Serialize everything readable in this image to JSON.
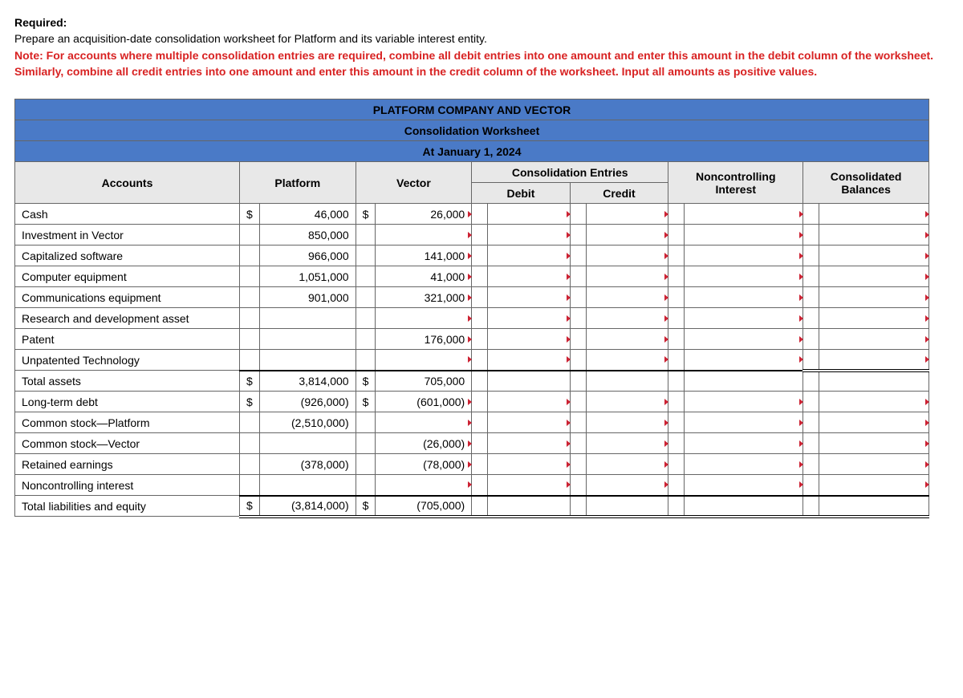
{
  "instructions": {
    "required_label": "Required:",
    "line1": "Prepare an acquisition-date consolidation worksheet for Platform and its variable interest entity.",
    "note": "Note: For accounts where multiple consolidation entries are required, combine all debit entries into one amount and enter this amount in the debit column of the worksheet. Similarly, combine all credit entries into one amount and enter this amount in the credit column of the worksheet. Input all amounts as positive values."
  },
  "header": {
    "title": "PLATFORM COMPANY AND VECTOR",
    "subtitle": "Consolidation Worksheet",
    "date": "At January 1, 2024"
  },
  "columns": {
    "accounts": "Accounts",
    "platform": "Platform",
    "vector": "Vector",
    "consolidation": "Consolidation Entries",
    "debit": "Debit",
    "credit": "Credit",
    "nci": "Noncontrolling Interest",
    "consolidated": "Consolidated Balances"
  },
  "rows": {
    "cash": {
      "label": "Cash",
      "p_cur": "$",
      "p_val": "46,000",
      "v_cur": "$",
      "v_val": "26,000"
    },
    "invest": {
      "label": "Investment in Vector",
      "p_val": "850,000"
    },
    "capsoft": {
      "label": "Capitalized software",
      "p_val": "966,000",
      "v_val": "141,000"
    },
    "compeq": {
      "label": "Computer equipment",
      "p_val": "1,051,000",
      "v_val": "41,000"
    },
    "commeq": {
      "label": "Communications equipment",
      "p_val": "901,000",
      "v_val": "321,000"
    },
    "rnd": {
      "label": "Research and development asset"
    },
    "patent": {
      "label": "Patent",
      "v_val": "176,000"
    },
    "unpat": {
      "label": "Unpatented Technology"
    },
    "tassets": {
      "label": "Total assets",
      "p_cur": "$",
      "p_val": "3,814,000",
      "v_cur": "$",
      "v_val": "705,000"
    },
    "ltd": {
      "label": "Long-term debt",
      "p_cur": "$",
      "p_val": "(926,000)",
      "v_cur": "$",
      "v_val": "(601,000)"
    },
    "csplat": {
      "label": "Common stock—Platform",
      "p_val": "(2,510,000)"
    },
    "csvec": {
      "label": "Common stock—Vector",
      "v_val": "(26,000)"
    },
    "re": {
      "label": "Retained earnings",
      "p_val": "(378,000)",
      "v_val": "(78,000)"
    },
    "nci": {
      "label": "Noncontrolling interest"
    },
    "tliab": {
      "label": "Total liabilities and equity",
      "p_cur": "$",
      "p_val": "(3,814,000)",
      "v_cur": "$",
      "v_val": "(705,000)"
    }
  }
}
